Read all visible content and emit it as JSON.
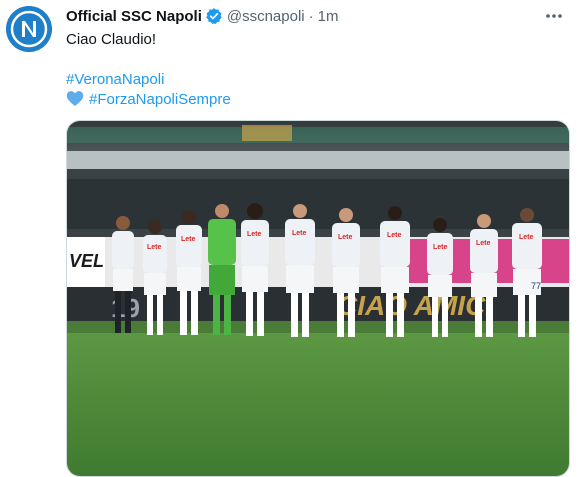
{
  "tweet": {
    "display_name": "Official SSC Napoli",
    "handle": "@sscnapoli",
    "separator": "·",
    "time": "1m",
    "text_line1": "Ciao Claudio!",
    "hashtag1": "#VeronaNapoli",
    "heart_emoji": "blue-heart",
    "hashtag2": "#ForzaNapoliSempre"
  },
  "media": {
    "sponsor_text": "Lete",
    "banner_fragment": "VEL",
    "stand_text": "19",
    "banner_text": "CIAO AMICI",
    "shirt_numbers": [
      "77"
    ],
    "pitch_color": "#4f8a3a",
    "kit_color": "#f2f4f8",
    "goalkeeper_kit_color": "#56c24a"
  },
  "colors": {
    "brand_blue": "#1f7fc8",
    "link": "#1d9bf0",
    "verified": "#1d9bf0",
    "muted": "#536471"
  },
  "icons": {
    "verified": "verified-badge-icon",
    "more": "more-options-icon"
  }
}
